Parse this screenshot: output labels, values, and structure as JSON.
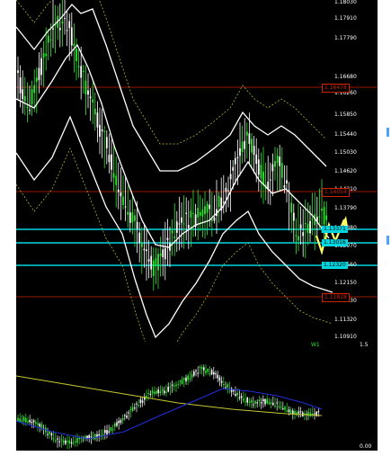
{
  "main_axis": {
    "labels": [
      "1.18030",
      "1.17910",
      "1.17790",
      "1.16680",
      "1.16260",
      "1.15850",
      "1.15440",
      "1.15030",
      "1.14620",
      "1.14210",
      "1.13790",
      "1.13380",
      "1.12970",
      "1.12560",
      "1.12150",
      "1.11730",
      "1.11320",
      "1.10910"
    ]
  },
  "levels": [
    {
      "label": "1.16478",
      "color": "#cc2200",
      "kind": "red"
    },
    {
      "label": "1.14054",
      "color": "#cc2200",
      "kind": "red"
    },
    {
      "label": "1.13371",
      "color": "#00d5e0",
      "kind": "cyan"
    },
    {
      "label": "1.13016",
      "color": "#00d5e0",
      "kind": "cyan"
    },
    {
      "label": "1.12320",
      "color": "#00d5e0",
      "kind": "cyan"
    },
    {
      "label": "1.11828",
      "color": "#cc2200",
      "kind": "red"
    }
  ],
  "indicator": {
    "tag": "W1",
    "top_label": "1.5",
    "bottom_label": "0.00"
  },
  "colors": {
    "bull": "#2ee62e",
    "bear": "#ffffff",
    "band": "#ffffff",
    "dotted": "#c8c832",
    "projection": "#ffff66",
    "ma_blue": "#1f2fd8",
    "ma_yellow": "#c8c832"
  },
  "chart_data": {
    "type": "candlestick",
    "y_axis_ticks": [
      1.1803,
      1.1791,
      1.1779,
      1.1668,
      1.1626,
      1.1585,
      1.1544,
      1.1503,
      1.1462,
      1.1421,
      1.1379,
      1.1338,
      1.1297,
      1.1256,
      1.1215,
      1.1173,
      1.1132,
      1.1091
    ],
    "horizontal_levels": [
      1.16478,
      1.14054,
      1.13371,
      1.13016,
      1.1232,
      1.11828
    ],
    "indicator_range": [
      0,
      1.5
    ]
  }
}
